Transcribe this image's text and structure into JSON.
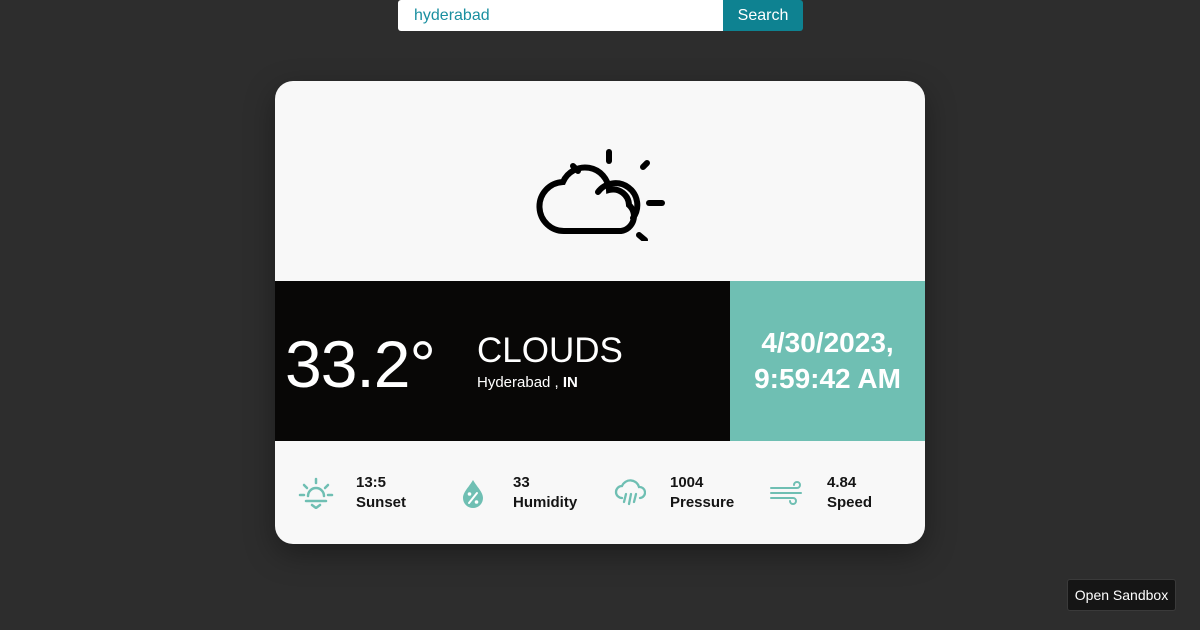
{
  "search": {
    "value": "hyderabad",
    "button_label": "Search"
  },
  "weather": {
    "temperature": "33.2°",
    "condition": "CLOUDS",
    "city": "Hyderabad , ",
    "country": "IN",
    "date": "4/30/2023,",
    "time": "9:59:42 AM",
    "main_icon": "partly-cloudy-icon"
  },
  "stats": [
    {
      "value": "13:5",
      "label": "Sunset",
      "icon": "sunset-icon"
    },
    {
      "value": "33",
      "label": "Humidity",
      "icon": "humidity-icon"
    },
    {
      "value": "1004",
      "label": "Pressure",
      "icon": "pressure-icon"
    },
    {
      "value": "4.84",
      "label": "Speed",
      "icon": "wind-icon"
    }
  ],
  "footer": {
    "open_sandbox": "Open Sandbox"
  },
  "colors": {
    "accent": "#6fbfb3",
    "button": "#0e8291",
    "dark": "#080706",
    "input_text": "#1a8fa0"
  }
}
